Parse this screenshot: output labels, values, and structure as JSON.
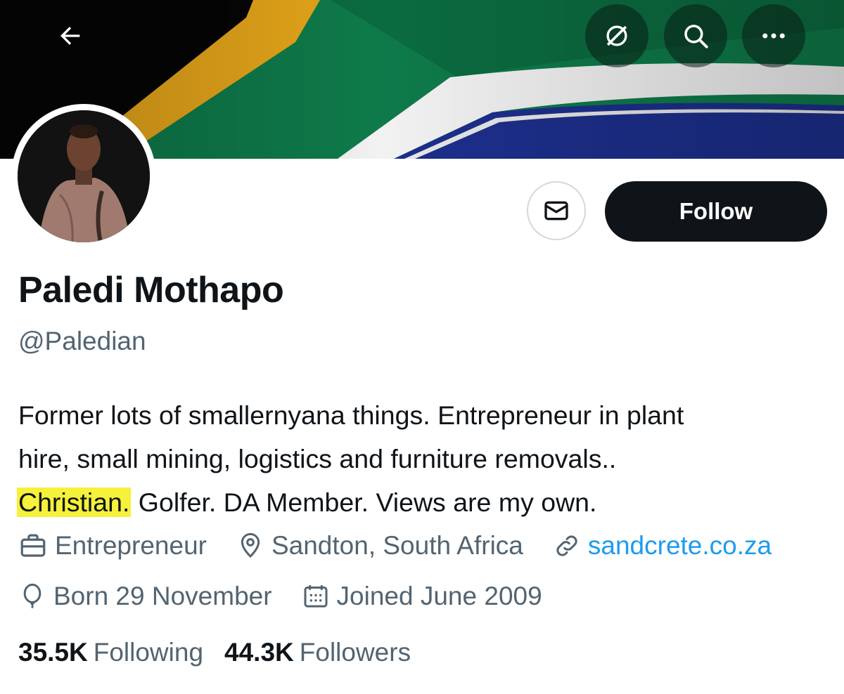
{
  "header": {
    "back_icon": "arrow-left-icon",
    "grok_icon": "grok-slash-icon",
    "search_icon": "search-icon",
    "more_icon": "more-dots-icon"
  },
  "profile": {
    "display_name": "Paledi Mothapo",
    "handle": "@Paledian",
    "follow_label": "Follow",
    "message_icon": "mail-icon",
    "bio": {
      "line1": "Former lots of smallernyana things. Entrepreneur in plant",
      "line2": "hire, small mining, logistics and furniture removals..",
      "line3_highlight": "Christian.",
      "line3_rest": " Golfer. DA Member. Views are my own."
    },
    "meta": {
      "occupation": "Entrepreneur",
      "location": "Sandton, South Africa",
      "website": "sandcrete.co.za",
      "birthday": "Born 29 November",
      "joined": "Joined June 2009"
    },
    "stats": {
      "following_count": "35.5K",
      "following_label": "Following",
      "followers_count": "44.3K",
      "followers_label": "Followers"
    }
  },
  "colors": {
    "accent": "#1d9bf0",
    "highlight": "#f6f13a",
    "secondary_text": "#536471",
    "primary_text": "#0f1419"
  }
}
